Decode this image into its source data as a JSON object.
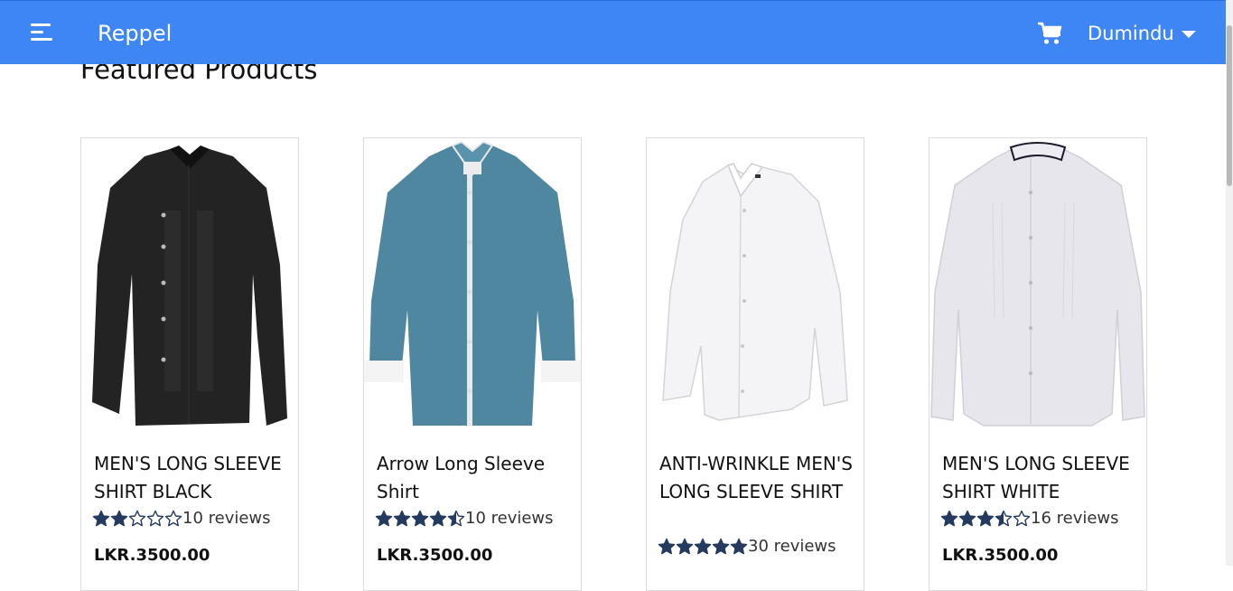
{
  "navbar": {
    "brand": "Reppel",
    "user_name": "Dumindu",
    "menu_icon": "hamburger-menu-icon",
    "cart_icon": "shopping-cart-icon",
    "dropdown_icon": "caret-down-icon",
    "color": "#3f86f5"
  },
  "section": {
    "title": "Featured Products"
  },
  "products": [
    {
      "name": "MEN'S LONG SLEEVE SHIRT BLACK",
      "rating": 2,
      "reviews": "10 reviews",
      "price": "LKR.3500.00"
    },
    {
      "name": "Arrow Long Sleeve Shirt",
      "rating": 4.5,
      "reviews": "10 reviews",
      "price": "LKR.3500.00"
    },
    {
      "name": "ANTI-WRINKLE MEN'S LONG SLEEVE SHIRT",
      "rating": 5,
      "reviews": "30 reviews",
      "price": ""
    },
    {
      "name": "MEN'S LONG SLEEVE SHIRT WHITE",
      "rating": 3.5,
      "reviews": "16 reviews",
      "price": "LKR.3500.00"
    }
  ],
  "star_color": "#243a5e"
}
